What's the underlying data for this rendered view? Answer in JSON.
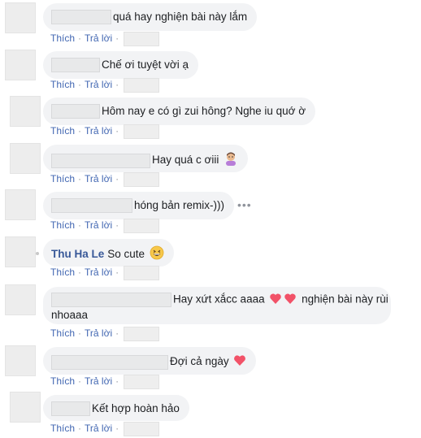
{
  "actions": {
    "like": "Thích",
    "reply": "Trả lời",
    "separator": "·"
  },
  "more_options": "•••",
  "comments": [
    {
      "author": "",
      "text": "quá hay nghiện bài này lắm"
    },
    {
      "author": "",
      "text": "Chế ơi tuyệt vời ạ"
    },
    {
      "author": "",
      "text": "Hôm nay e có gì zui hông? Nghe iu quớ ờ"
    },
    {
      "author": "",
      "text": "Hay quá c ơiii",
      "emoji": "person-gesturing-icon"
    },
    {
      "author": "",
      "text": "hóng bản remix-)))"
    },
    {
      "author": "Thu Ha Le",
      "text": "So cute",
      "emoji": "grinning-face-icon"
    },
    {
      "author": "",
      "text_line1": "Hay xứt xắcc aaaa",
      "text_line1_after": "nghiện bài này rùi",
      "text_line2": "nhoaaa",
      "emoji": "two-hearts-icon"
    },
    {
      "author": "",
      "text": "Đợi cả ngày",
      "emoji": "heart-icon"
    },
    {
      "author": "",
      "text": "Kết hợp hoàn hảo"
    }
  ]
}
